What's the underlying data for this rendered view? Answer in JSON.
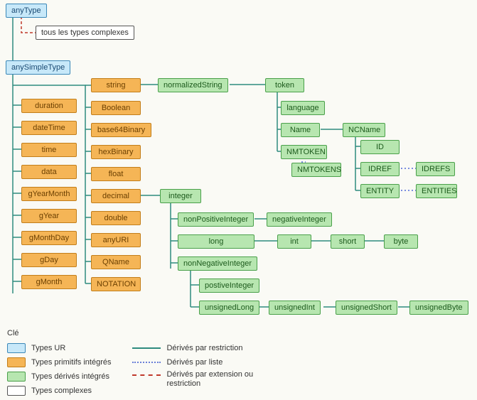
{
  "root": {
    "anyType": "anyType",
    "complex": "tous les types complexes",
    "anySimpleType": "anySimpleType"
  },
  "col1": [
    "duration",
    "dateTime",
    "time",
    "data",
    "gYearMonth",
    "gYear",
    "gMonthDay",
    "gDay",
    "gMonth"
  ],
  "col2": [
    "string",
    "Boolean",
    "base64Binary",
    "hexBinary",
    "float",
    "decimal",
    "double",
    "anyURI",
    "QName",
    "NOTATION"
  ],
  "stringBranch": {
    "normalizedString": "normalizedString",
    "token": "token",
    "language": "language",
    "Name": "Name",
    "NMTOKEN": "NMTOKEN",
    "NMTOKENS": "NMTOKENS",
    "NCName": "NCName",
    "ID": "ID",
    "IDREF": "IDREF",
    "IDREFS": "IDREFS",
    "ENTITY": "ENTITY",
    "ENTITIES": "ENTITIES"
  },
  "integerBranch": {
    "integer": "integer",
    "nonPositiveInteger": "nonPositiveInteger",
    "negativeInteger": "negativeInteger",
    "long": "long",
    "int": "int",
    "short": "short",
    "byte": "byte",
    "nonNegativeInteger": "nonNegativeInteger",
    "positiveInteger": "postiveInteger",
    "unsignedLong": "unsignedLong",
    "unsignedInt": "unsignedInt",
    "unsignedShort": "unsignedShort",
    "unsignedByte": "unsignedByte"
  },
  "legend": {
    "title": "Clé",
    "ur": "Types UR",
    "prim": "Types primitifs intégrés",
    "deriv": "Types dérivés intégrés",
    "complex": "Types complexes",
    "restriction": "Dérivés par restriction",
    "liste": "Dérivés par liste",
    "extRest": "Dérivés par extension ou restriction"
  }
}
